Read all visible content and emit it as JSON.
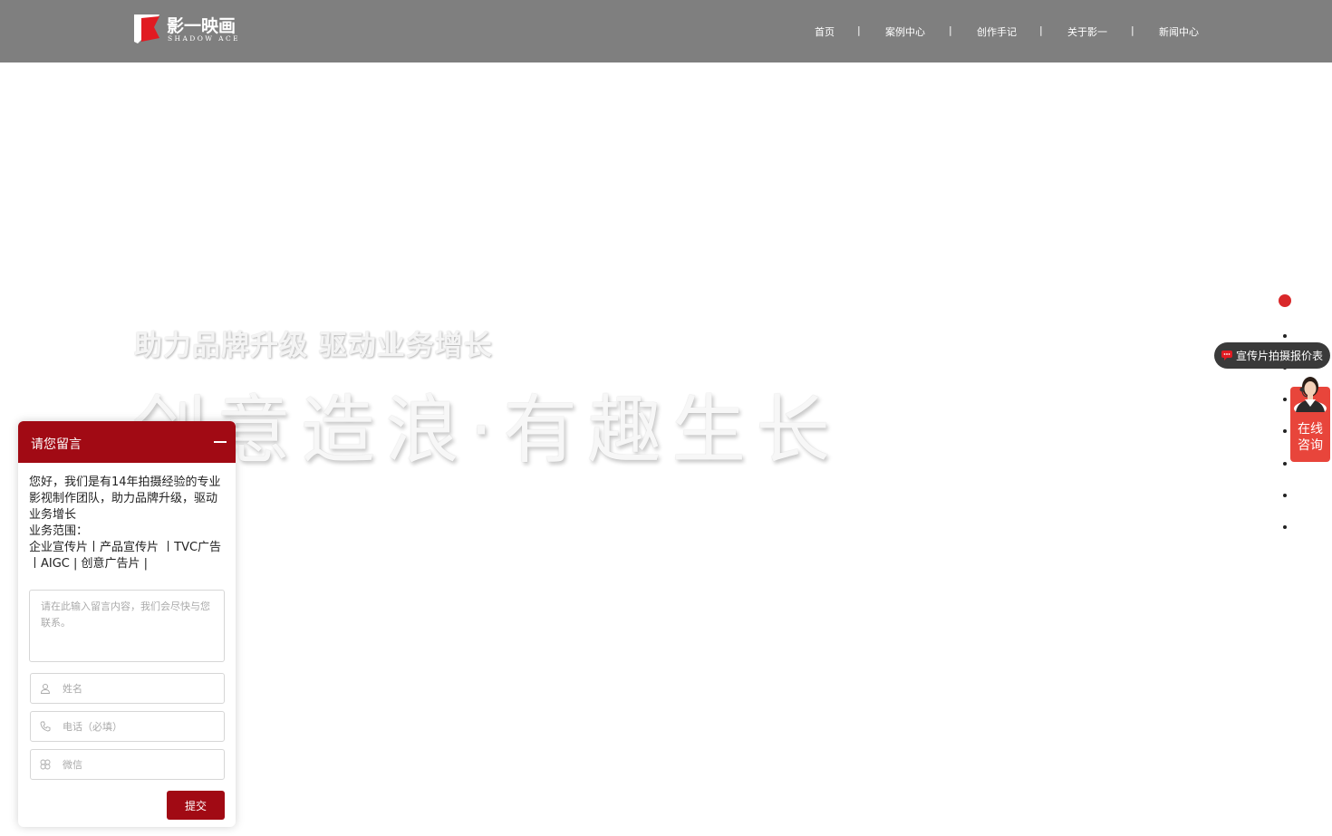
{
  "header": {
    "logo_cn": "影一映画",
    "logo_en": "SHADOW ACE",
    "nav": [
      {
        "label": "首页"
      },
      {
        "label": "案例中心"
      },
      {
        "label": "创作手记"
      },
      {
        "label": "关于影一"
      },
      {
        "label": "新闻中心"
      }
    ],
    "separator": "|"
  },
  "hero": {
    "subtitle": "助力品牌升级  驱动业务增长",
    "title": "创意造浪·有趣生长"
  },
  "side": {
    "dots_count": 8,
    "active_dot": 1,
    "price_pill": "宣传片拍摄报价表",
    "consult_line1": "在线",
    "consult_line2": "咨询"
  },
  "panel": {
    "title": "请您留言",
    "intro_line1": "您好，我们是有14年拍摄经验的专业影视制作团队，助力品牌升级，驱动业务增长",
    "intro_line2": "业务范围：",
    "intro_line3": "企业宣传片丨产品宣传片 丨TVC广告 丨AIGC | 创意广告片 |",
    "message_placeholder": "请在此输入留言内容，我们会尽快与您联系。",
    "name_placeholder": "姓名",
    "phone_placeholder": "电话（必填）",
    "wechat_placeholder": "微信",
    "submit_label": "提交"
  },
  "colors": {
    "header_bg": "#7f7f7f",
    "accent_red": "#a10a14",
    "dot_active": "#d9282a",
    "consult_bg": "#e8453b"
  }
}
